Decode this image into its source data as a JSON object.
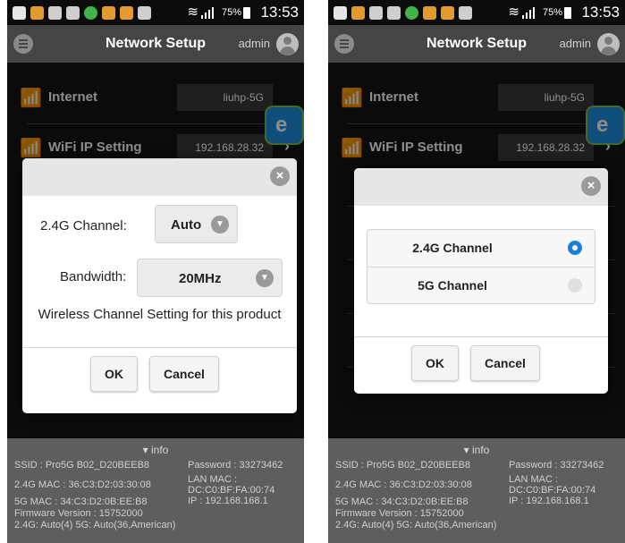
{
  "status_bar": {
    "time": "13:53",
    "battery": "75%"
  },
  "header": {
    "title": "Network Setup",
    "user": "admin"
  },
  "settings_rows": [
    {
      "label": "Internet",
      "value": "liuhp-5G",
      "icon": "wifi-globe-icon"
    },
    {
      "label": "WiFi IP Setting",
      "value": "192.168.28.32",
      "icon": "wifi-ip-icon"
    }
  ],
  "app_badge": {
    "letter": "e"
  },
  "channel_dialog": {
    "channel_label": "2.4G Channel:",
    "channel_value": "Auto",
    "bandwidth_label": "Bandwidth:",
    "bandwidth_value": "20MHz",
    "note": "Wireless Channel Setting for this product",
    "ok_label": "OK",
    "cancel_label": "Cancel"
  },
  "band_dialog": {
    "options": [
      {
        "label": "2.4G Channel",
        "selected": true
      },
      {
        "label": "5G Channel",
        "selected": false
      }
    ],
    "ok_label": "OK",
    "cancel_label": "Cancel"
  },
  "info": {
    "toggle": "info",
    "ssid": "SSID : Pro5G B02_D20BEEB8",
    "password": "Password : 33273462",
    "mac_24g": "2.4G MAC : 36:C3:D2:03:30:08",
    "lan_mac_label": "LAN MAC :",
    "lan_mac_value": "DC:C0:BF:FA:00:74",
    "mac_5g": "5G MAC : 34:C3:D2:0B:EE:B8",
    "ip": "IP : 192.168.168.1",
    "firmware": "Firmware Version : 15752000",
    "channels": "2.4G: Auto(4)   5G: Auto(36,American)"
  },
  "colors": {
    "accent_blue": "#1a7fd8",
    "app_badge": "#1e8fe0",
    "background": "#141414",
    "topbar": "#454545"
  }
}
